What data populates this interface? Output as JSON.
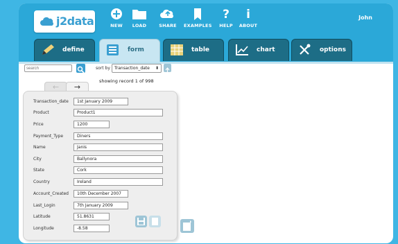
{
  "app": {
    "brand": "j2data",
    "user": "John"
  },
  "nav": [
    {
      "label": "NEW",
      "icon": "plus-circle-icon"
    },
    {
      "label": "LOAD",
      "icon": "folder-icon"
    },
    {
      "label": "SHARE",
      "icon": "share-cloud-icon"
    },
    {
      "label": "EXAMPLES",
      "icon": "bookmark-icon"
    },
    {
      "label": "HELP",
      "icon": "question-icon"
    },
    {
      "label": "ABOUT",
      "icon": "info-icon"
    }
  ],
  "tabs": [
    {
      "label": "define",
      "icon": "pencil-icon"
    },
    {
      "label": "form",
      "icon": "form-icon",
      "active": true
    },
    {
      "label": "table",
      "icon": "table-icon"
    },
    {
      "label": "chart",
      "icon": "chart-icon"
    },
    {
      "label": "options",
      "icon": "tools-icon"
    }
  ],
  "toolbar": {
    "search_placeholder": "search",
    "sort_label": "sort by",
    "sort_value": "Transaction_date"
  },
  "status": "showing record 1 of 998",
  "pager": {
    "prev": "←",
    "next": "→"
  },
  "record": [
    {
      "label": "Transaction_date",
      "value": "1st January 2009"
    },
    {
      "label": "Product",
      "value": "Product1"
    },
    {
      "label": "Price",
      "value": "1200"
    },
    {
      "label": "Payment_Type",
      "value": "Diners"
    },
    {
      "label": "Name",
      "value": "Janis"
    },
    {
      "label": "City",
      "value": "Ballynora"
    },
    {
      "label": "State",
      "value": "Cork"
    },
    {
      "label": "Country",
      "value": "Ireland"
    },
    {
      "label": "Account_Created",
      "value": "10th December 2007"
    },
    {
      "label": "Last_Login",
      "value": "7th January 2009"
    },
    {
      "label": "Latitude",
      "value": "51.8631"
    },
    {
      "label": "Longitude",
      "value": "-8.58"
    }
  ],
  "colors": {
    "background": "#3fb6e4",
    "header": "#2ba8d8",
    "tab_dark": "#1d6d86",
    "tab_active": "#c8e6f2"
  }
}
